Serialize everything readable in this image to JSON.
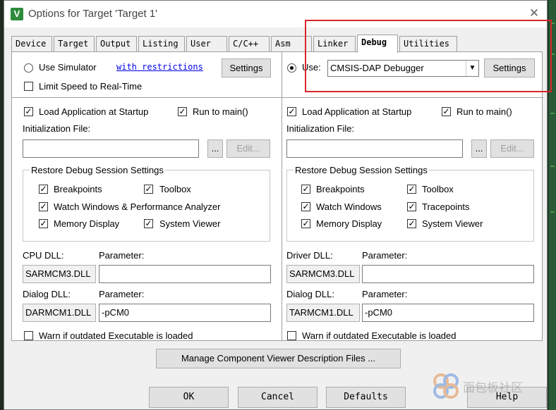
{
  "window": {
    "title": "Options for Target 'Target 1'",
    "icon": "keil-uvision-icon"
  },
  "tabs": [
    "Device",
    "Target",
    "Output",
    "Listing",
    "User",
    "C/C++",
    "Asm",
    "Linker",
    "Debug",
    "Utilities"
  ],
  "active_tab": "Debug",
  "left": {
    "use_simulator": "Use Simulator",
    "with_restrictions": "with restrictions",
    "settings": "Settings",
    "limit_speed": "Limit Speed to Real-Time",
    "load_app": "Load Application at Startup",
    "run_to_main": "Run to main()",
    "init_file_label": "Initialization File:",
    "browse": "...",
    "edit": "Edit...",
    "restore_title": "Restore Debug Session Settings",
    "breakpoints": "Breakpoints",
    "toolbox": "Toolbox",
    "watch_windows": "Watch Windows & Performance Analyzer",
    "memory_display": "Memory Display",
    "system_viewer": "System Viewer",
    "cpu_dll_label": "CPU DLL:",
    "cpu_param_label": "Parameter:",
    "cpu_dll": "SARMCM3.DLL",
    "cpu_param": "",
    "dialog_dll_label": "Dialog DLL:",
    "dialog_param_label": "Parameter:",
    "dialog_dll": "DARMCM1.DLL",
    "dialog_param": "-pCM0",
    "warn": "Warn if outdated Executable is loaded"
  },
  "right": {
    "use": "Use:",
    "debugger": "CMSIS-DAP Debugger",
    "settings": "Settings",
    "load_app": "Load Application at Startup",
    "run_to_main": "Run to main()",
    "init_file_label": "Initialization File:",
    "browse": "...",
    "edit": "Edit...",
    "restore_title": "Restore Debug Session Settings",
    "breakpoints": "Breakpoints",
    "toolbox": "Toolbox",
    "watch_windows": "Watch Windows",
    "tracepoints": "Tracepoints",
    "memory_display": "Memory Display",
    "system_viewer": "System Viewer",
    "driver_dll_label": "Driver DLL:",
    "driver_param_label": "Parameter:",
    "driver_dll": "SARMCM3.DLL",
    "driver_param": "",
    "dialog_dll_label": "Dialog DLL:",
    "dialog_param_label": "Parameter:",
    "dialog_dll": "TARMCM1.DLL",
    "dialog_param": "-pCM0",
    "warn": "Warn if outdated Executable is loaded"
  },
  "manage_button": "Manage Component Viewer Description Files ...",
  "footer": {
    "ok": "OK",
    "cancel": "Cancel",
    "defaults": "Defaults",
    "help": "Help"
  },
  "watermark": {
    "text": "面包板社区"
  },
  "colors": {
    "highlight": "#d9262c",
    "link": "#0000ee"
  }
}
